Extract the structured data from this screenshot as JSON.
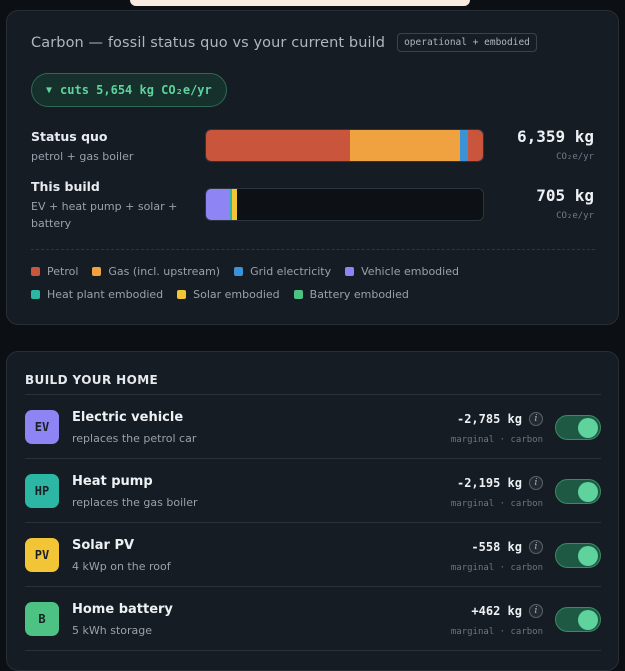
{
  "carbon": {
    "title": "Carbon — fossil status quo vs your current build",
    "tag": "operational + embodied",
    "cuts_caret": "▼",
    "cuts_label": "cuts 5,654 kg CO₂e/yr",
    "rows": [
      {
        "name": "Status quo",
        "sub": "petrol + gas boiler",
        "value": "6,359 kg",
        "unit": "CO₂e/yr",
        "total": 6359,
        "segments": [
          {
            "category": "Petrol",
            "value": 3300,
            "color": "#c9553d"
          },
          {
            "category": "Gas (incl. upstream)",
            "value": 2520,
            "color": "#f0a240"
          },
          {
            "category": "Grid electricity",
            "value": 200,
            "color": "#3b93d6"
          },
          {
            "category": "Petrol",
            "value": 339,
            "color": "#c9553d"
          }
        ]
      },
      {
        "name": "This build",
        "sub": "EV + heat pump + solar + battery",
        "value": "705 kg",
        "unit": "CO₂e/yr",
        "total": 705,
        "segments": [
          {
            "category": "Vehicle embodied",
            "value": 560,
            "color": "#8f84f4"
          },
          {
            "category": "Heat plant embodied",
            "value": 35,
            "color": "#2cb7a5"
          },
          {
            "category": "Solar embodied",
            "value": 110,
            "color": "#f2c537"
          }
        ]
      }
    ],
    "legend": [
      {
        "label": "Petrol",
        "color": "#c9553d"
      },
      {
        "label": "Gas (incl. upstream)",
        "color": "#f0a240"
      },
      {
        "label": "Grid electricity",
        "color": "#3b93d6"
      },
      {
        "label": "Vehicle embodied",
        "color": "#8f84f4"
      },
      {
        "label": "Heat plant embodied",
        "color": "#2cb7a5"
      },
      {
        "label": "Solar embodied",
        "color": "#f2c537"
      },
      {
        "label": "Battery embodied",
        "color": "#4cc382"
      }
    ]
  },
  "build": {
    "title": "BUILD YOUR HOME",
    "items": [
      {
        "badge": "EV",
        "badge_color": "#8f84f4",
        "name": "Electric vehicle",
        "sub": "replaces the petrol car",
        "value": "-2,785 kg",
        "info": "i",
        "meta": "marginal · carbon",
        "enabled": true
      },
      {
        "badge": "HP",
        "badge_color": "#2cb7a5",
        "name": "Heat pump",
        "sub": "replaces the gas boiler",
        "value": "-2,195 kg",
        "info": "i",
        "meta": "marginal · carbon",
        "enabled": true
      },
      {
        "badge": "PV",
        "badge_color": "#f2c537",
        "name": "Solar PV",
        "sub": "4 kWp on the roof",
        "value": "-558 kg",
        "info": "i",
        "meta": "marginal · carbon",
        "enabled": true
      },
      {
        "badge": "B",
        "badge_color": "#4cc382",
        "name": "Home battery",
        "sub": "5 kWh storage",
        "value": "+462 kg",
        "info": "i",
        "meta": "marginal · carbon",
        "enabled": true
      }
    ]
  }
}
